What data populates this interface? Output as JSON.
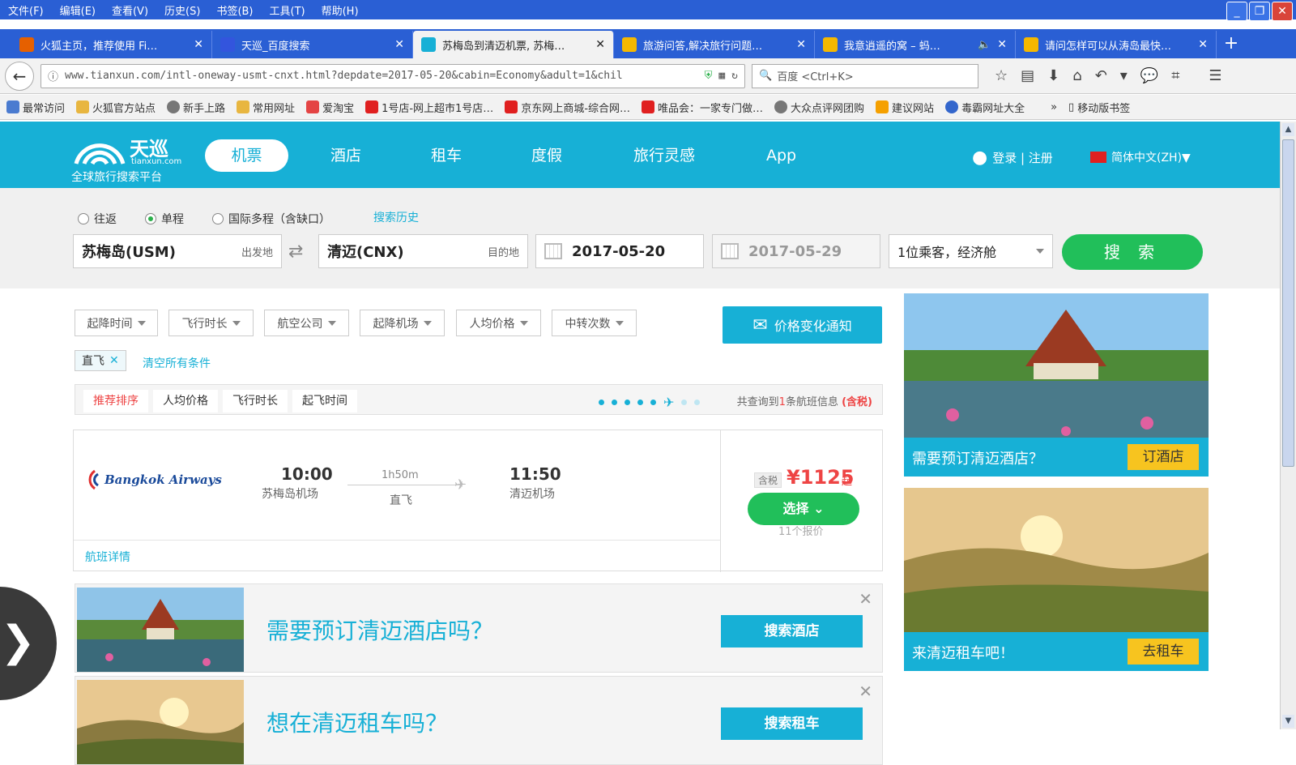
{
  "menubar": [
    "文件(F)",
    "编辑(E)",
    "查看(V)",
    "历史(S)",
    "书签(B)",
    "工具(T)",
    "帮助(H)"
  ],
  "tabs": [
    {
      "title": "火狐主页，推荐使用 Fi…",
      "icon_color": "#e66000"
    },
    {
      "title": "天巡_百度搜索",
      "icon_color": "#3355dd"
    },
    {
      "title": "苏梅岛到清迈机票, 苏梅…",
      "icon_color": "#17b0d6"
    },
    {
      "title": "旅游问答,解决旅行问题…",
      "icon_color": "#f5b800"
    },
    {
      "title": "我意逍遥的窝 – 蚂…",
      "icon_color": "#f5b800"
    },
    {
      "title": "请问怎样可以从涛岛最快…",
      "icon_color": "#f5b800"
    }
  ],
  "tab_close": "✕",
  "new_tab": "+",
  "url": "www.tianxun.com/intl-oneway-usmt-cnxt.html?depdate=2017-05-20&cabin=Economy&adult=1&chil",
  "search_placeholder": "百度 <Ctrl+K>",
  "bookmarks": [
    {
      "label": "最常访问",
      "color": "#4a7bd0"
    },
    {
      "label": "火狐官方站点",
      "color": "#e8b640"
    },
    {
      "label": "新手上路",
      "color": "#777777"
    },
    {
      "label": "常用网址",
      "color": "#e8b640"
    },
    {
      "label": "爱淘宝",
      "color": "#e44444"
    },
    {
      "label": "1号店-网上超市1号店…",
      "color": "#e02020"
    },
    {
      "label": "京东网上商城-综合网…",
      "color": "#e02020"
    },
    {
      "label": "唯品会：一家专门做…",
      "color": "#e02020"
    },
    {
      "label": "大众点评网团购",
      "color": "#777777"
    },
    {
      "label": "建议网站",
      "color": "#f5a000"
    },
    {
      "label": "毒霸网址大全",
      "color": "#3366cc"
    }
  ],
  "bookmarks_more": "»",
  "mobile_bookmarks": "移动版书签",
  "site": {
    "logo_cn": "天巡",
    "logo_en": "tianxun.com",
    "slogan": "全球旅行搜索平台",
    "nav": [
      "机票",
      "酒店",
      "租车",
      "度假",
      "旅行灵感",
      "App"
    ],
    "login": "登录 | 注册",
    "language": "简体中文(ZH)▼"
  },
  "search": {
    "trip_types": [
      "往返",
      "单程",
      "国际多程（含缺口）"
    ],
    "selected_trip": "单程",
    "history": "搜索历史",
    "origin": "苏梅岛(USM)",
    "origin_hint": "出发地",
    "destination": "清迈(CNX)",
    "destination_hint": "目的地",
    "depart_date": "2017-05-20",
    "return_date": "2017-05-29",
    "passengers": "1位乘客，经济舱",
    "search_button": "搜 索"
  },
  "filters": [
    "起降时间",
    "飞行时长",
    "航空公司",
    "起降机场",
    "人均价格",
    "中转次数"
  ],
  "price_notify": "价格变化通知",
  "active_filter": "直飞",
  "clear_filters": "清空所有条件",
  "sort": {
    "options": [
      "推荐排序",
      "人均价格",
      "飞行时长",
      "起飞时间"
    ],
    "result_prefix": "共查询到",
    "result_count": "1",
    "result_suffix": "条航班信息",
    "tax_note": "(含税)"
  },
  "flight": {
    "airline": "Bangkok Airways",
    "depart_time": "10:00",
    "depart_airport": "苏梅岛机场",
    "duration": "1h50m",
    "stops": "直飞",
    "arrive_time": "11:50",
    "arrive_airport": "清迈机场",
    "tax_badge": "含税",
    "price": "¥1125",
    "price_suffix": "起",
    "select_button": "选择 ⌄",
    "quotes": "11个报价",
    "details_link": "航班详情"
  },
  "promos": [
    {
      "text": "需要预订清迈酒店吗？",
      "button": "搜索酒店"
    },
    {
      "text": "想在清迈租车吗？",
      "button": "搜索租车"
    }
  ],
  "side_ads": [
    {
      "text": "需要预订清迈酒店？",
      "button": "订酒店"
    },
    {
      "text": "来清迈租车吧！",
      "button": "去租车"
    }
  ]
}
